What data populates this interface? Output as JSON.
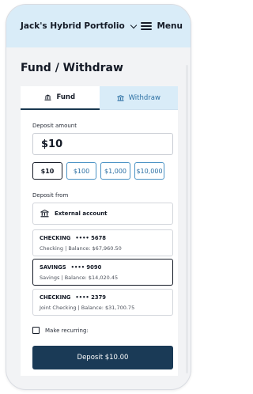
{
  "header": {
    "portfolio_name": "Jack's Hybrid Portfolio",
    "menu_label": "Menu"
  },
  "page": {
    "title": "Fund / Withdraw"
  },
  "tabs": [
    {
      "label": "Fund",
      "active": true,
      "icon": "bank-icon"
    },
    {
      "label": "Withdraw",
      "active": false,
      "icon": "bank-icon"
    }
  ],
  "deposit": {
    "amount_label": "Deposit amount",
    "amount_value": "$10",
    "presets": [
      "$10",
      "$100",
      "$1,000",
      "$10,000"
    ],
    "selected_preset": "$10"
  },
  "source": {
    "label": "Deposit from",
    "external_label": "External account",
    "accounts": [
      {
        "type": "CHECKING",
        "mask": "•••• 5678",
        "detail": "Checking | Balance: $67,960.50",
        "selected": false
      },
      {
        "type": "SAVINGS",
        "mask": "•••• 9090",
        "detail": "Savings | Balance: $14,020.45",
        "selected": true
      },
      {
        "type": "CHECKING",
        "mask": "•••• 2379",
        "detail": "Joint Checking | Balance: $31,700.75",
        "selected": false
      }
    ]
  },
  "recurring": {
    "label": "Make recurring:",
    "checked": false
  },
  "submit": {
    "label": "Deposit $10.00"
  },
  "colors": {
    "header_bg": "#d9ecf8",
    "primary": "#1a3a56",
    "link": "#2b6fa3"
  }
}
